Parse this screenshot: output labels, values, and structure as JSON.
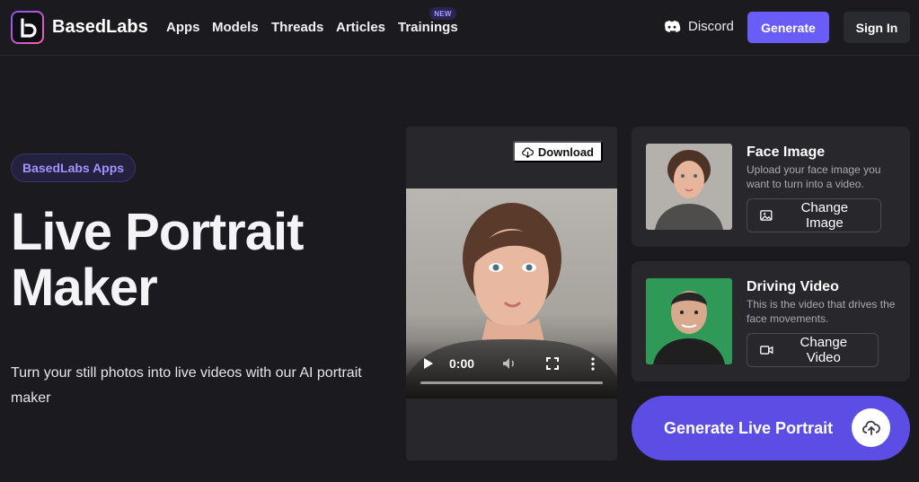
{
  "brand": {
    "name": "BasedLabs"
  },
  "nav": {
    "items": [
      "Apps",
      "Models",
      "Threads",
      "Articles",
      "Trainings"
    ],
    "badge": "NEW",
    "discord": "Discord",
    "generate": "Generate",
    "signin": "Sign In"
  },
  "hero": {
    "pill": "BasedLabs Apps",
    "title": "Live Portrait Maker",
    "description": "Turn your still photos into live videos with our AI portrait maker"
  },
  "video": {
    "download": "Download",
    "time": "0:00",
    "progress": 0
  },
  "face_card": {
    "title": "Face Image",
    "description": "Upload your face image you want to turn into a video.",
    "button": "Change Image"
  },
  "driving_card": {
    "title": "Driving Video",
    "description": "This is the video that drives the face movements.",
    "button": "Change Video"
  },
  "cta": {
    "label": "Generate Live Portrait"
  },
  "colors": {
    "background": "#1a1a1f",
    "accent": "#6a5cf7",
    "card": "#27272c",
    "green_screen": "#2f9a57"
  }
}
